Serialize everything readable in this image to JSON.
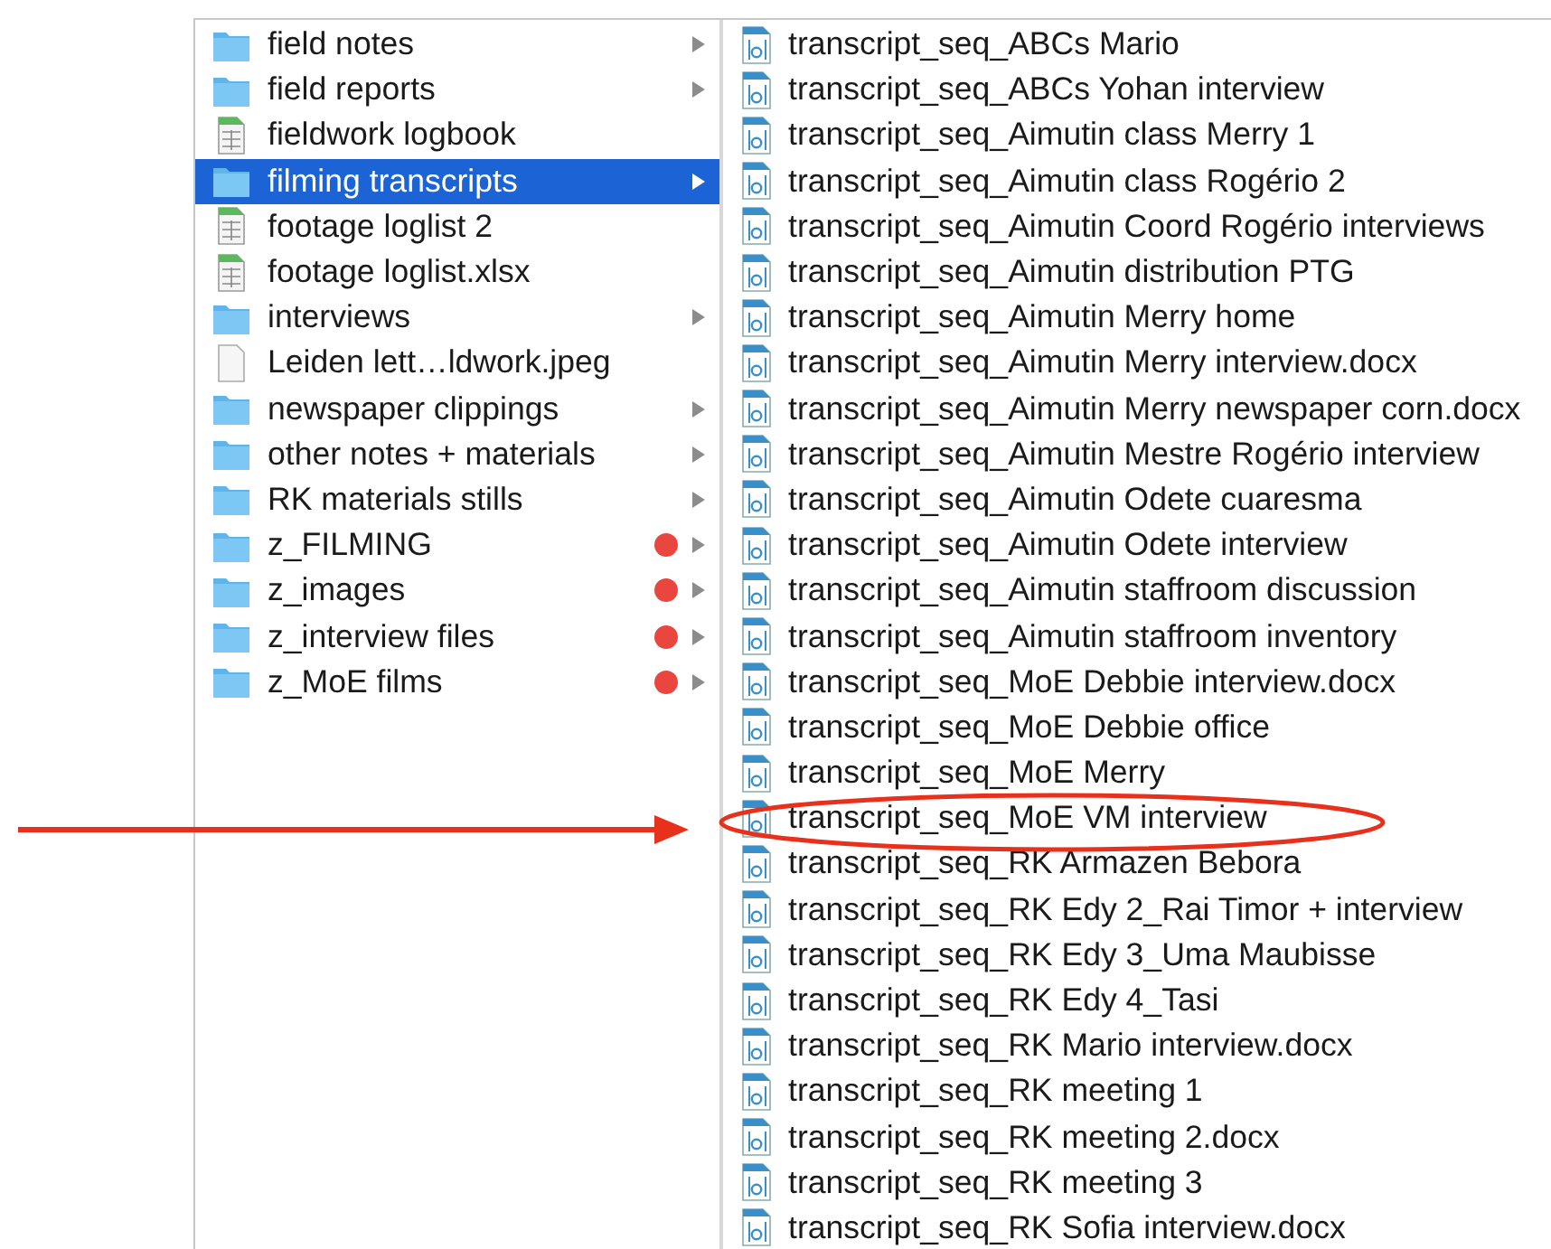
{
  "columns": [
    {
      "items": [
        {
          "name": "field notes",
          "kind": "folder",
          "arrow": true,
          "selected": false
        },
        {
          "name": "field reports",
          "kind": "folder",
          "arrow": true,
          "selected": false
        },
        {
          "name": "fieldwork logbook",
          "kind": "sheet",
          "arrow": false,
          "selected": false
        },
        {
          "name": "filming transcripts",
          "kind": "folder",
          "arrow": true,
          "selected": true
        },
        {
          "name": "footage loglist 2",
          "kind": "sheet",
          "arrow": false,
          "selected": false
        },
        {
          "name": "footage loglist.xlsx",
          "kind": "sheet",
          "arrow": false,
          "selected": false
        },
        {
          "name": "interviews",
          "kind": "folder",
          "arrow": true,
          "selected": false
        },
        {
          "name": "Leiden lett…ldwork.jpeg",
          "kind": "image",
          "arrow": false,
          "selected": false
        },
        {
          "name": "newspaper clippings",
          "kind": "folder",
          "arrow": true,
          "selected": false
        },
        {
          "name": "other notes + materials",
          "kind": "folder",
          "arrow": true,
          "selected": false
        },
        {
          "name": "RK materials stills",
          "kind": "folder",
          "arrow": true,
          "selected": false
        },
        {
          "name": "z_FILMING",
          "kind": "folder",
          "arrow": true,
          "selected": false,
          "color": "#e8463f"
        },
        {
          "name": "z_images",
          "kind": "folder",
          "arrow": true,
          "selected": false,
          "color": "#e8463f"
        },
        {
          "name": "z_interview files",
          "kind": "folder",
          "arrow": true,
          "selected": false,
          "color": "#e8463f"
        },
        {
          "name": "z_MoE films",
          "kind": "folder",
          "arrow": true,
          "selected": false,
          "color": "#e8463f"
        }
      ]
    },
    {
      "items": [
        {
          "name": "transcript_seq_ABCs Mario",
          "kind": "doc",
          "arrow": false,
          "selected": false
        },
        {
          "name": "transcript_seq_ABCs Yohan interview",
          "kind": "doc",
          "arrow": false,
          "selected": false
        },
        {
          "name": "transcript_seq_Aimutin class Merry 1",
          "kind": "doc",
          "arrow": false,
          "selected": false
        },
        {
          "name": "transcript_seq_Aimutin class Rogério 2",
          "kind": "doc",
          "arrow": false,
          "selected": false
        },
        {
          "name": "transcript_seq_Aimutin Coord Rogério interviews",
          "kind": "doc",
          "arrow": false,
          "selected": false
        },
        {
          "name": "transcript_seq_Aimutin distribution PTG",
          "kind": "doc",
          "arrow": false,
          "selected": false
        },
        {
          "name": "transcript_seq_Aimutin Merry home",
          "kind": "doc",
          "arrow": false,
          "selected": false
        },
        {
          "name": "transcript_seq_Aimutin Merry interview.docx",
          "kind": "doc",
          "arrow": false,
          "selected": false
        },
        {
          "name": "transcript_seq_Aimutin Merry newspaper corn.docx",
          "kind": "doc",
          "arrow": false,
          "selected": false
        },
        {
          "name": "transcript_seq_Aimutin Mestre Rogério interview",
          "kind": "doc",
          "arrow": false,
          "selected": false
        },
        {
          "name": "transcript_seq_Aimutin Odete cuaresma",
          "kind": "doc",
          "arrow": false,
          "selected": false
        },
        {
          "name": "transcript_seq_Aimutin Odete interview",
          "kind": "doc",
          "arrow": false,
          "selected": false
        },
        {
          "name": "transcript_seq_Aimutin staffroom discussion",
          "kind": "doc",
          "arrow": false,
          "selected": false
        },
        {
          "name": "transcript_seq_Aimutin staffroom inventory",
          "kind": "doc",
          "arrow": false,
          "selected": false
        },
        {
          "name": "transcript_seq_MoE Debbie interview.docx",
          "kind": "doc",
          "arrow": false,
          "selected": false
        },
        {
          "name": "transcript_seq_MoE Debbie office",
          "kind": "doc",
          "arrow": false,
          "selected": false
        },
        {
          "name": "transcript_seq_MoE Merry",
          "kind": "doc",
          "arrow": false,
          "selected": false
        },
        {
          "name": "transcript_seq_MoE VM interview",
          "kind": "doc",
          "arrow": false,
          "selected": false
        },
        {
          "name": "transcript_seq_RK Armazen Bebora",
          "kind": "doc",
          "arrow": false,
          "selected": false
        },
        {
          "name": "transcript_seq_RK Edy 2_Rai Timor + interview",
          "kind": "doc",
          "arrow": false,
          "selected": false
        },
        {
          "name": "transcript_seq_RK Edy 3_Uma Maubisse",
          "kind": "doc",
          "arrow": false,
          "selected": false
        },
        {
          "name": "transcript_seq_RK Edy 4_Tasi",
          "kind": "doc",
          "arrow": false,
          "selected": false
        },
        {
          "name": "transcript_seq_RK Mario interview.docx",
          "kind": "doc",
          "arrow": false,
          "selected": false
        },
        {
          "name": "transcript_seq_RK meeting 1",
          "kind": "doc",
          "arrow": false,
          "selected": false
        },
        {
          "name": "transcript_seq_RK meeting 2.docx",
          "kind": "doc",
          "arrow": false,
          "selected": false
        },
        {
          "name": "transcript_seq_RK meeting 3",
          "kind": "doc",
          "arrow": false,
          "selected": false
        },
        {
          "name": "transcript_seq_RK Sofia interview.docx",
          "kind": "doc",
          "arrow": false,
          "selected": false
        }
      ]
    }
  ]
}
